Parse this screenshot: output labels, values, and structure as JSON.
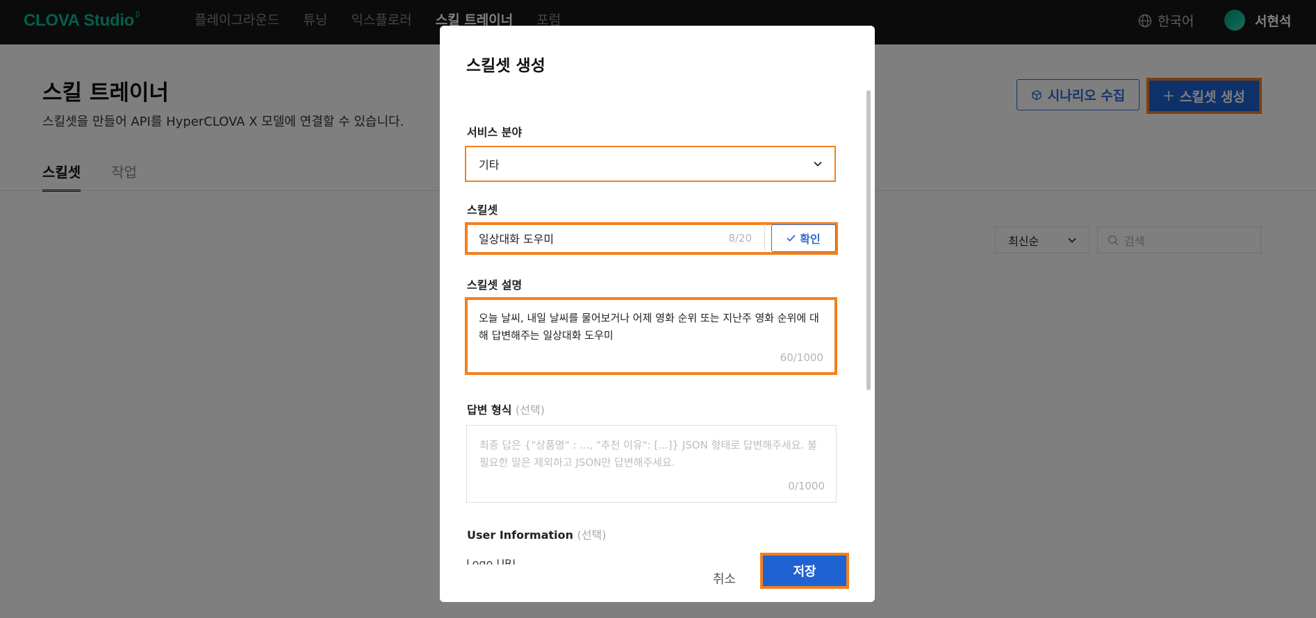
{
  "topbar": {
    "logo_text": "CLOVA Studio",
    "logo_sup": "β",
    "nav": [
      "플레이그라운드",
      "튜닝",
      "익스플로러",
      "스킬 트레이너",
      "포럼"
    ],
    "active_nav": "스킬 트레이너",
    "language": "한국어",
    "user_name": "서현석"
  },
  "page": {
    "title": "스킬 트레이너",
    "description": "스킬셋을 만들어 API를 HyperCLOVA X 모델에 연결할 수 있습니다.",
    "scenario_button": "시나리오 수집",
    "create_button": "스킬셋 생성",
    "tabs": [
      "스킬셋",
      "작업"
    ],
    "sort_value": "최신순",
    "search_placeholder": "검색"
  },
  "modal": {
    "title": "스킬셋 생성",
    "service_label": "서비스 분야",
    "service_value": "기타",
    "skillset_label": "스킬셋",
    "skillset_value": "일상대화 도우미",
    "skillset_count": "8/20",
    "confirm_button": "확인",
    "desc_label": "스킬셋 설명",
    "desc_value": "오늘 날씨, 내일 날씨를 물어보거나 어제 영화 순위 또는 지난주 영화 순위에 대해 답변해주는 일상대화 도우미",
    "desc_count": "60/1000",
    "answer_label": "답변 형식",
    "answer_optional": "(선택)",
    "answer_placeholder": "최종 답은 {\"상품명\" : ..., \"추천 이유\": [...]} JSON 형태로 답변해주세요. 불필요한 말은 제외하고 JSON만 답변해주세요.",
    "answer_count": "0/1000",
    "user_info_label": "User Information",
    "user_info_optional": "(선택)",
    "logo_url_label": "Logo URL",
    "cancel_button": "취소",
    "save_button": "저장"
  },
  "colors": {
    "brand_green": "#0bbd9b",
    "primary_blue": "#1f63d3",
    "highlight_orange": "#f47f1c"
  }
}
